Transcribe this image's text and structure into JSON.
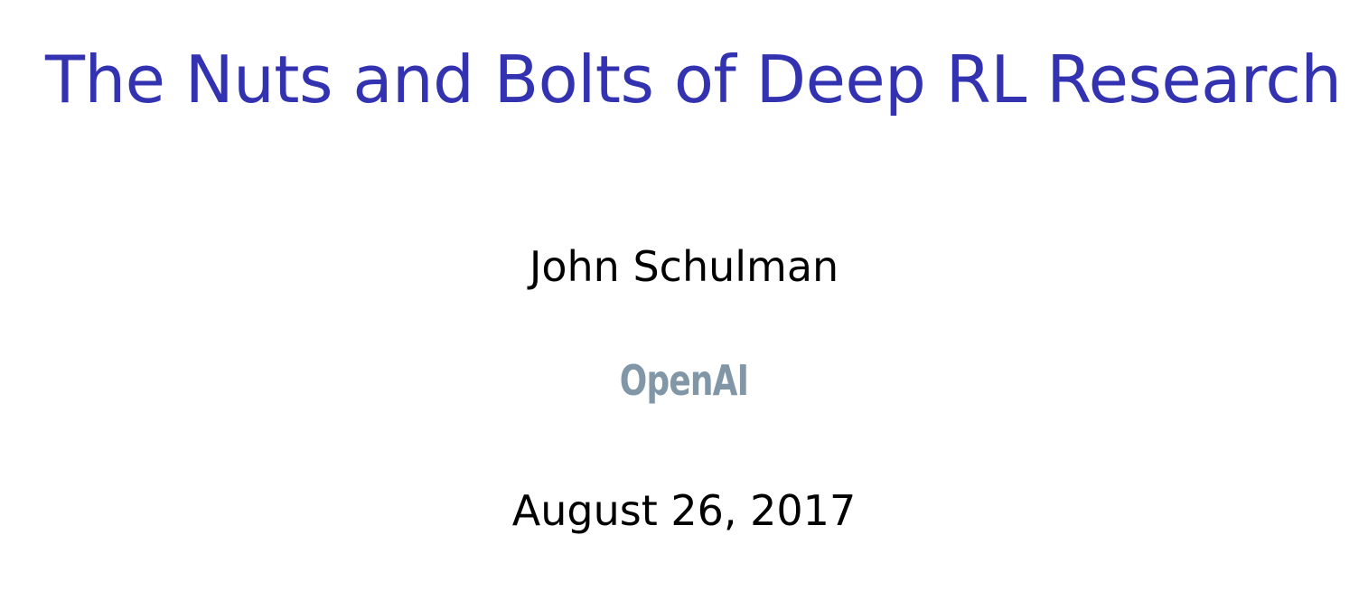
{
  "slide": {
    "title": "The Nuts and Bolts of Deep RL Research",
    "author": "John Schulman",
    "organization": "OpenAI",
    "date": "August 26, 2017"
  },
  "colors": {
    "title": "#3333b2",
    "text": "#000000",
    "logo": "#8197a7",
    "background": "#ffffff"
  }
}
